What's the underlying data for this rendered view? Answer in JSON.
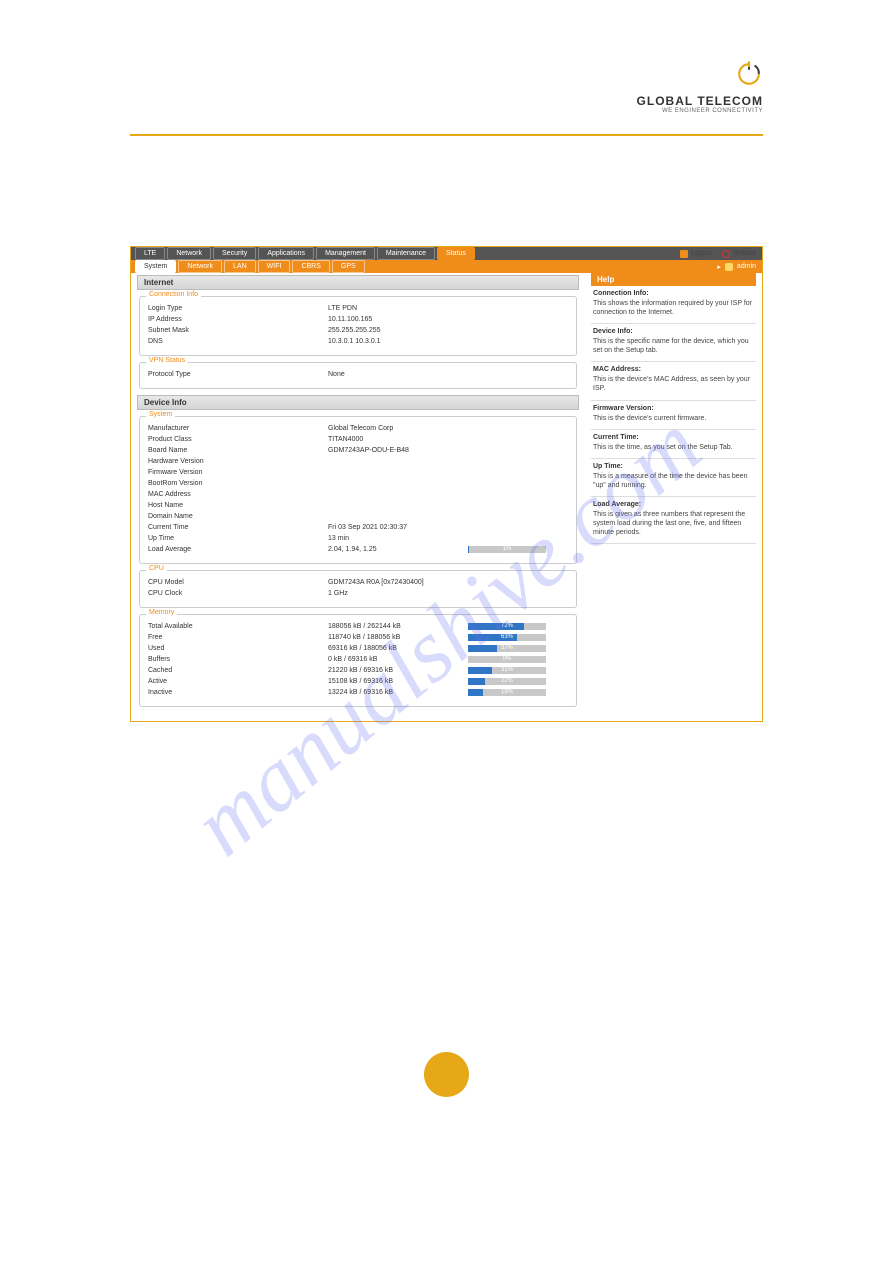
{
  "brand": {
    "name": "GLOBAL TELECOM",
    "tagline": "WE ENGINEER CONNECTIVITY"
  },
  "watermark": "manualshive.com",
  "main_tabs": [
    "LTE",
    "Network",
    "Security",
    "Applications",
    "Management",
    "Maintenance",
    "Status"
  ],
  "main_tab_active": 6,
  "top_actions": {
    "logout": "Logout",
    "reboot": "Reboot"
  },
  "sub_tabs": [
    "System",
    "Network",
    "LAN",
    "WIFI",
    "CBRS",
    "GPS"
  ],
  "sub_tab_active": 0,
  "user": {
    "name": "admin",
    "arrow": "▸"
  },
  "sections": {
    "internet": {
      "title": "Internet",
      "connection_info": {
        "legend": "Connection Info",
        "rows": [
          {
            "label": "Login Type",
            "value": "LTE PDN"
          },
          {
            "label": "IP Address",
            "value": "10.11.100.165"
          },
          {
            "label": "Subnet Mask",
            "value": "255.255.255.255"
          },
          {
            "label": "DNS",
            "value": "10.3.0.1   10.3.0.1"
          }
        ]
      },
      "vpn_status": {
        "legend": "VPN Status",
        "rows": [
          {
            "label": "Protocol Type",
            "value": "None"
          }
        ]
      }
    },
    "device_info": {
      "title": "Device Info",
      "system": {
        "legend": "System",
        "rows": [
          {
            "label": "Manufacturer",
            "value": "Global Telecom Corp"
          },
          {
            "label": "Product Class",
            "value": "TITAN4000"
          },
          {
            "label": "Board Name",
            "value": "GDM7243AP-ODU-E-B48"
          },
          {
            "label": "Hardware Version",
            "value": ""
          },
          {
            "label": "Firmware Version",
            "value": ""
          },
          {
            "label": "BootRom Version",
            "value": ""
          },
          {
            "label": "MAC Address",
            "value": ""
          },
          {
            "label": "Host Name",
            "value": ""
          },
          {
            "label": "Domain Name",
            "value": ""
          },
          {
            "label": "Current Time",
            "value": "Fri 03 Sep 2021 02:30:37"
          },
          {
            "label": "Up Time",
            "value": "13 min"
          },
          {
            "label": "Load Average",
            "value": "2.04, 1.94, 1.25",
            "bar_pct": 1,
            "bar_label": "1%"
          }
        ]
      },
      "cpu": {
        "legend": "CPU",
        "rows": [
          {
            "label": "CPU Model",
            "value": "GDM7243A R0A [0x72430400]"
          },
          {
            "label": "CPU Clock",
            "value": "1 GHz"
          }
        ]
      },
      "memory": {
        "legend": "Memory",
        "rows": [
          {
            "label": "Total Available",
            "value": "188056 kB / 262144 kB",
            "bar_pct": 72,
            "bar_label": "72%"
          },
          {
            "label": "Free",
            "value": "118740 kB / 188056 kB",
            "bar_pct": 63,
            "bar_label": "63%"
          },
          {
            "label": "Used",
            "value": "69316 kB / 188056 kB",
            "bar_pct": 37,
            "bar_label": "37%"
          },
          {
            "label": "Buffers",
            "value": "0 kB / 69316 kB",
            "bar_pct": 0,
            "bar_label": "0%"
          },
          {
            "label": "Cached",
            "value": "21220 kB / 69316 kB",
            "bar_pct": 31,
            "bar_label": "31%"
          },
          {
            "label": "Active",
            "value": "15108 kB / 69316 kB",
            "bar_pct": 22,
            "bar_label": "22%"
          },
          {
            "label": "Inactive",
            "value": "13224 kB / 69316 kB",
            "bar_pct": 19,
            "bar_label": "19%"
          }
        ]
      }
    }
  },
  "help": {
    "title": "Help",
    "blocks": [
      {
        "title": "Connection Info:",
        "text": "This shows the information required by your ISP for connection to the Internet."
      },
      {
        "title": "Device Info:",
        "text": "This is the specific name for the device, which you set on the Setup tab."
      },
      {
        "title": "MAC Address:",
        "text": "This is the device's MAC Address, as seen by your ISP."
      },
      {
        "title": "Firmware Version:",
        "text": "This is the device's current firmware."
      },
      {
        "title": "Current Time:",
        "text": "This is the time, as you set on the Setup Tab."
      },
      {
        "title": "Up Time:",
        "text": "This is a measure of the time the device has been \"up\" and running."
      },
      {
        "title": "Load Average:",
        "text": "This is given as three numbers that represent the system load during the last one, five, and fifteen minute periods."
      }
    ]
  }
}
